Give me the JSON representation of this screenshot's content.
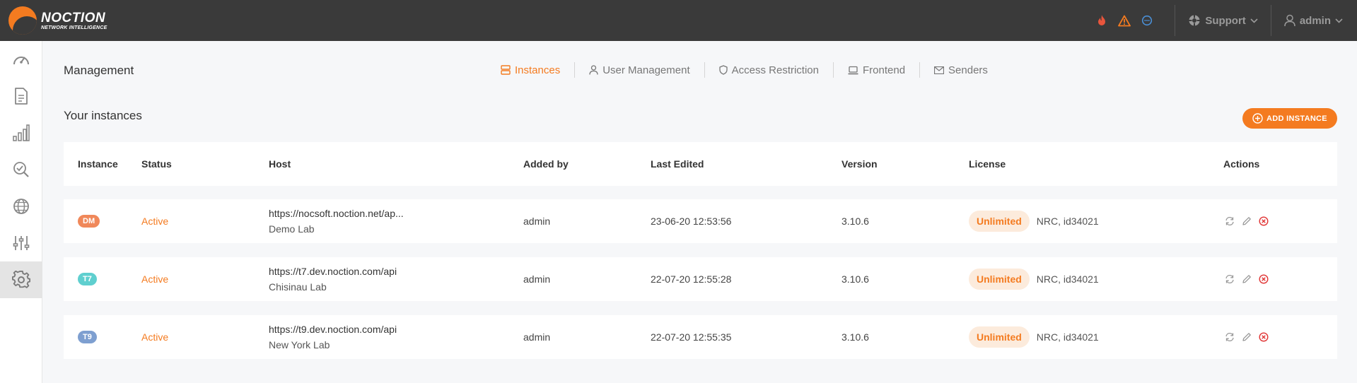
{
  "brand": {
    "name": "NOCTION",
    "tagline": "NETWORK INTELLIGENCE",
    "accent": "#f47b20"
  },
  "topbar": {
    "alerts": [
      {
        "icon": "flame-icon",
        "color": "#e8553c"
      },
      {
        "icon": "warning-icon",
        "color": "#f47b20"
      },
      {
        "icon": "chat-icon",
        "color": "#4a8fd6"
      }
    ],
    "support_label": "Support",
    "user_label": "admin"
  },
  "sidebar": {
    "items": [
      {
        "name": "dashboard",
        "icon": "speedometer-icon"
      },
      {
        "name": "reports",
        "icon": "document-icon"
      },
      {
        "name": "statistics",
        "icon": "bar-chart-icon"
      },
      {
        "name": "analysis",
        "icon": "magnifier-check-icon"
      },
      {
        "name": "network",
        "icon": "globe-icon"
      },
      {
        "name": "settings",
        "icon": "sliders-icon"
      },
      {
        "name": "management",
        "icon": "gear-icon",
        "active": true
      }
    ]
  },
  "page": {
    "title": "Management"
  },
  "tabs": [
    {
      "label": "Instances",
      "icon": "server-icon",
      "active": true
    },
    {
      "label": "User Management",
      "icon": "user-icon"
    },
    {
      "label": "Access Restriction",
      "icon": "shield-icon"
    },
    {
      "label": "Frontend",
      "icon": "laptop-icon"
    },
    {
      "label": "Senders",
      "icon": "envelope-icon"
    }
  ],
  "instances": {
    "title": "Your instances",
    "add_label": "ADD INSTANCE",
    "columns": [
      "Instance",
      "Status",
      "Host",
      "Added by",
      "Last Edited",
      "Version",
      "License",
      "Actions"
    ],
    "rows": [
      {
        "code": "DM",
        "badge_color": "#f0885a",
        "status": "Active",
        "host_url": "https://nocsoft.noction.net/ap...",
        "host_name": "Demo Lab",
        "added_by": "admin",
        "last_edited": "23-06-20 12:53:56",
        "version": "3.10.6",
        "license": "Unlimited",
        "license_detail": "NRC, id34021"
      },
      {
        "code": "T7",
        "badge_color": "#5fcfcf",
        "status": "Active",
        "host_url": "https://t7.dev.noction.com/api",
        "host_name": "Chisinau Lab",
        "added_by": "admin",
        "last_edited": "22-07-20 12:55:28",
        "version": "3.10.6",
        "license": "Unlimited",
        "license_detail": "NRC, id34021"
      },
      {
        "code": "T9",
        "badge_color": "#7e9fd0",
        "status": "Active",
        "host_url": "https://t9.dev.noction.com/api",
        "host_name": "New York Lab",
        "added_by": "admin",
        "last_edited": "22-07-20 12:55:35",
        "version": "3.10.6",
        "license": "Unlimited",
        "license_detail": "NRC, id34021"
      }
    ]
  }
}
